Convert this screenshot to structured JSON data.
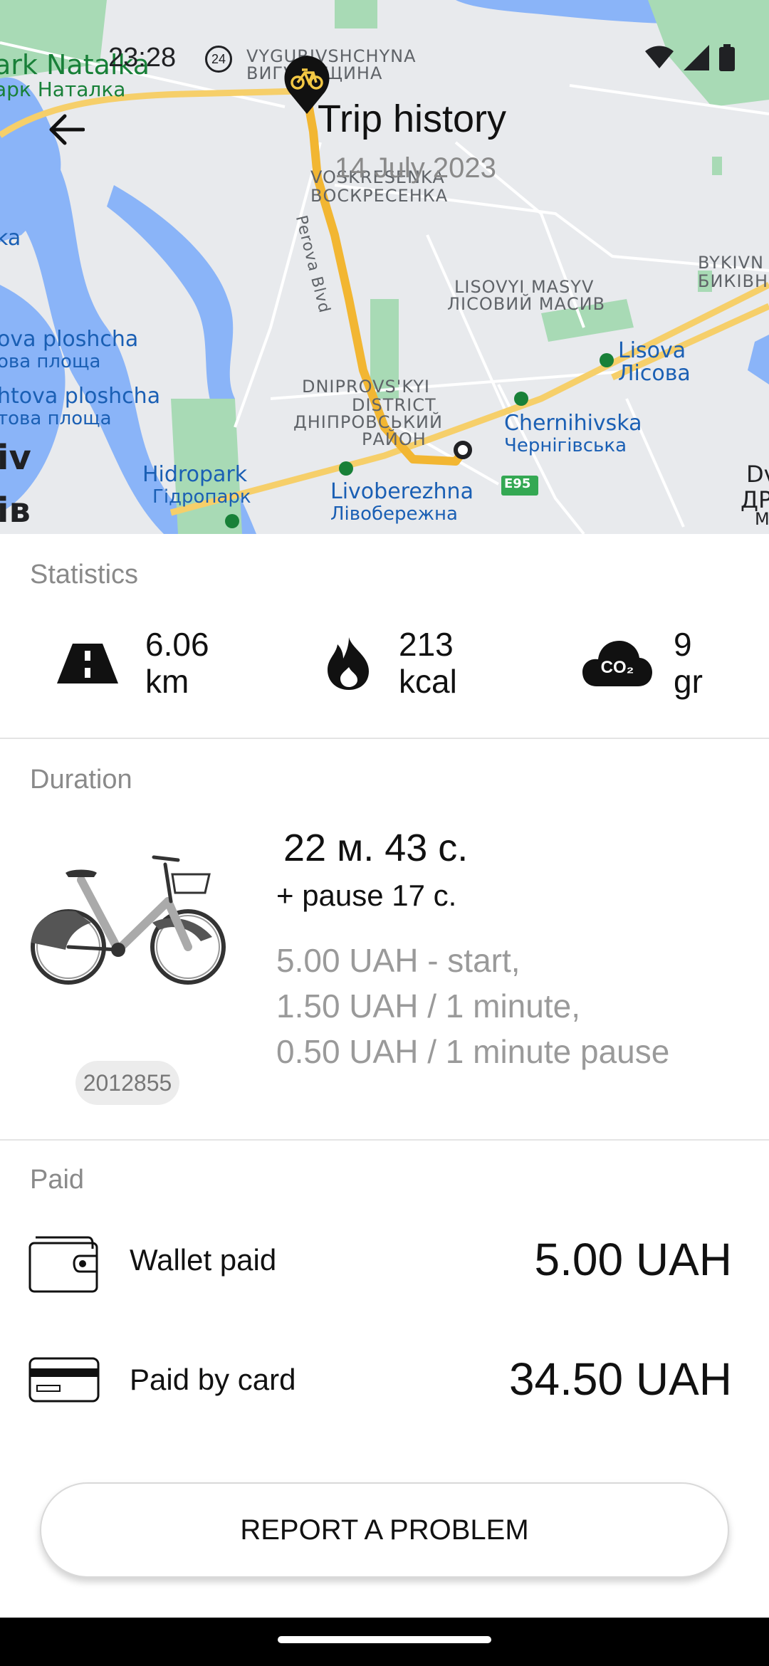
{
  "status_bar": {
    "time": "23:28",
    "badge": "24"
  },
  "header": {
    "title": "Trip history",
    "date": "14 July 2023"
  },
  "map": {
    "labels": {
      "natalka_en": "ark Natalka",
      "natalka_uk": "арк Наталка",
      "vygurivshchyna_en": "VYGURIVSHCHYNA",
      "vygurivshchyna_uk": "ВИГУРІВЩИНА",
      "voskresenka_en": "VOSKRESENKA",
      "voskresenka_uk": "ВОСКРЕСЕНКА",
      "perova": "Perova Blvd",
      "bykivnia_en": "BYKIVN",
      "bykivnia_uk": "БИКІВН",
      "lisovyi_en": "LISOVYI MASYV",
      "lisovyi_uk": "ЛІСОВИЙ МАСИВ",
      "ka": "ka",
      "lova_en": "ova ploshcha",
      "lova_uk": "ова площа",
      "poshtova_en": "htova ploshcha",
      "poshtova_uk": "това площа",
      "lisova_en": "Lisova",
      "lisova_uk": "Лісова",
      "dniprovskyi_1": "DNIPROVS'KYI",
      "dniprovskyi_2": "DISTRICT",
      "dniprovskyi_3": "ДНІПРОВСЬКИЙ",
      "dniprovskyi_4": "РАЙОН",
      "chernihivska_en": "Chernihivska",
      "chernihivska_uk": "Чернігівська",
      "iv": "iv",
      "iv_uk": "ів",
      "hidropark_en": "Hidropark",
      "hidropark_uk": "Гідропарк",
      "livoberezhna_en": "Livoberezhna",
      "livoberezhna_uk": "Лівобережна",
      "e95": "E95",
      "dv": "Dv",
      "dv_uk": "ДР",
      "m": "M"
    }
  },
  "statistics": {
    "label": "Statistics",
    "distance": {
      "value": "6.06",
      "unit": "km",
      "icon": "road-icon"
    },
    "calories": {
      "value": "213",
      "unit": "kcal",
      "icon": "flame-icon"
    },
    "co2": {
      "value": "9",
      "unit": "gr",
      "icon": "co2-cloud-icon",
      "icon_text": "CO₂"
    }
  },
  "duration": {
    "label": "Duration",
    "time": "22 м. 43 с.",
    "pause": "+ pause  17 с.",
    "bike_id": "2012855",
    "tariff": [
      "5.00 UAH - start,",
      "1.50 UAH / 1 minute,",
      "0.50 UAH / 1 minute pause"
    ]
  },
  "paid": {
    "label": "Paid",
    "wallet": {
      "label": "Wallet paid",
      "amount": "5.00 UAH"
    },
    "card": {
      "label": "Paid by card",
      "amount": "34.50 UAH"
    }
  },
  "actions": {
    "report": "REPORT A PROBLEM"
  },
  "colors": {
    "route": "#f2b632",
    "water": "#8ab4f8",
    "park": "#a8dab5",
    "map_bg": "#e8eaed"
  }
}
